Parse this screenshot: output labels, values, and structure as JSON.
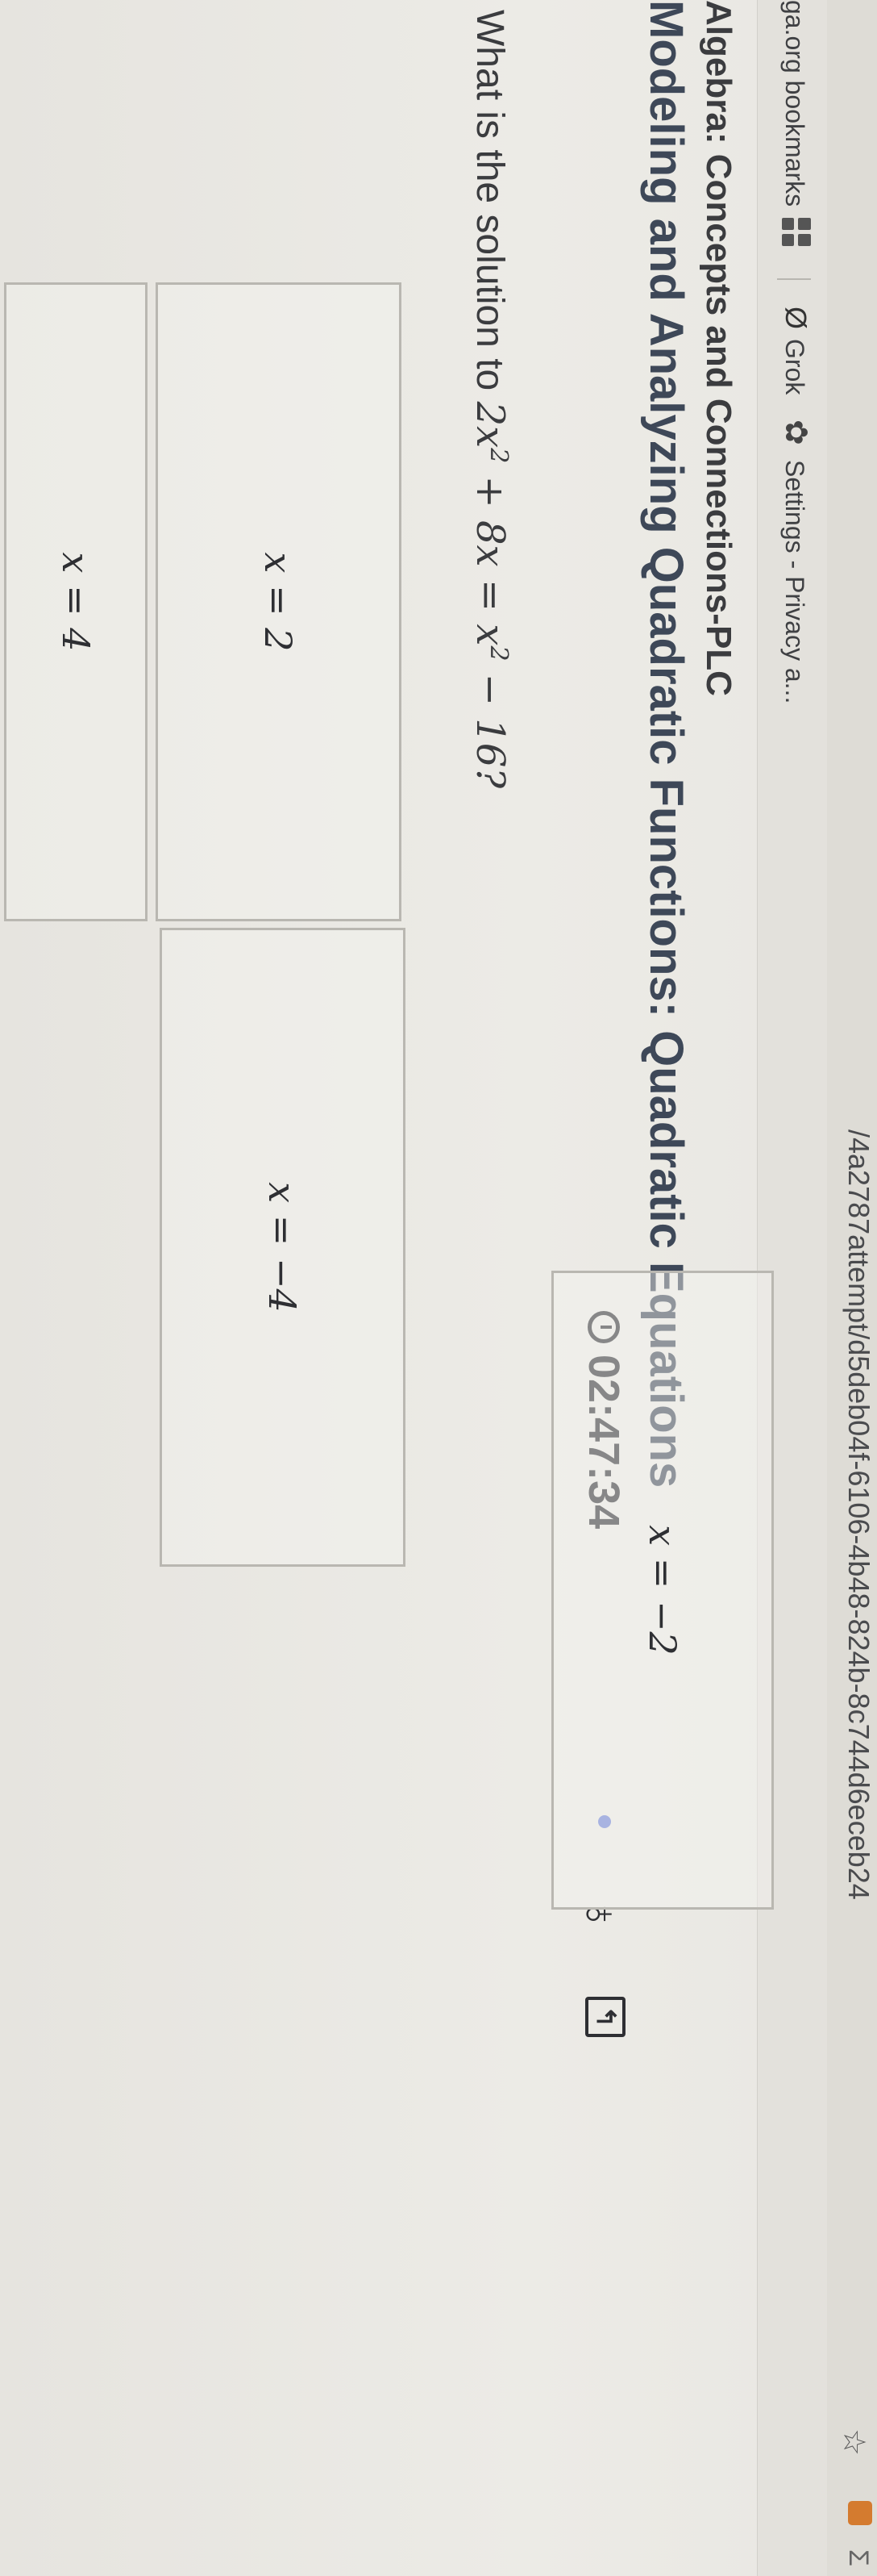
{
  "browser": {
    "url_fragment": "/4a2787attempt/d5deb04f-6106-4b48-824b-8c744d6eceb24",
    "bookmarks": [
      {
        "label": "ga.org bookmarks"
      },
      {
        "label": "Grok"
      },
      {
        "label": "Settings - Privacy a..."
      }
    ]
  },
  "header": {
    "course_title": "Algebra: Concepts and Connections-PLC",
    "lesson_title": "Modeling and Analyzing Quadratic Functions: Quadratic Equations"
  },
  "timer": {
    "value": "02:47:34"
  },
  "question": {
    "prefix": "What is the solution to ",
    "term1": "2x",
    "exp1": "2",
    "term2": " + 8x = x",
    "exp2": "2",
    "term3": " − 16?"
  },
  "choices": [
    {
      "label": "x = 2"
    },
    {
      "label": "x = −4"
    },
    {
      "label": "x = −2"
    },
    {
      "label": "x = 4"
    }
  ]
}
